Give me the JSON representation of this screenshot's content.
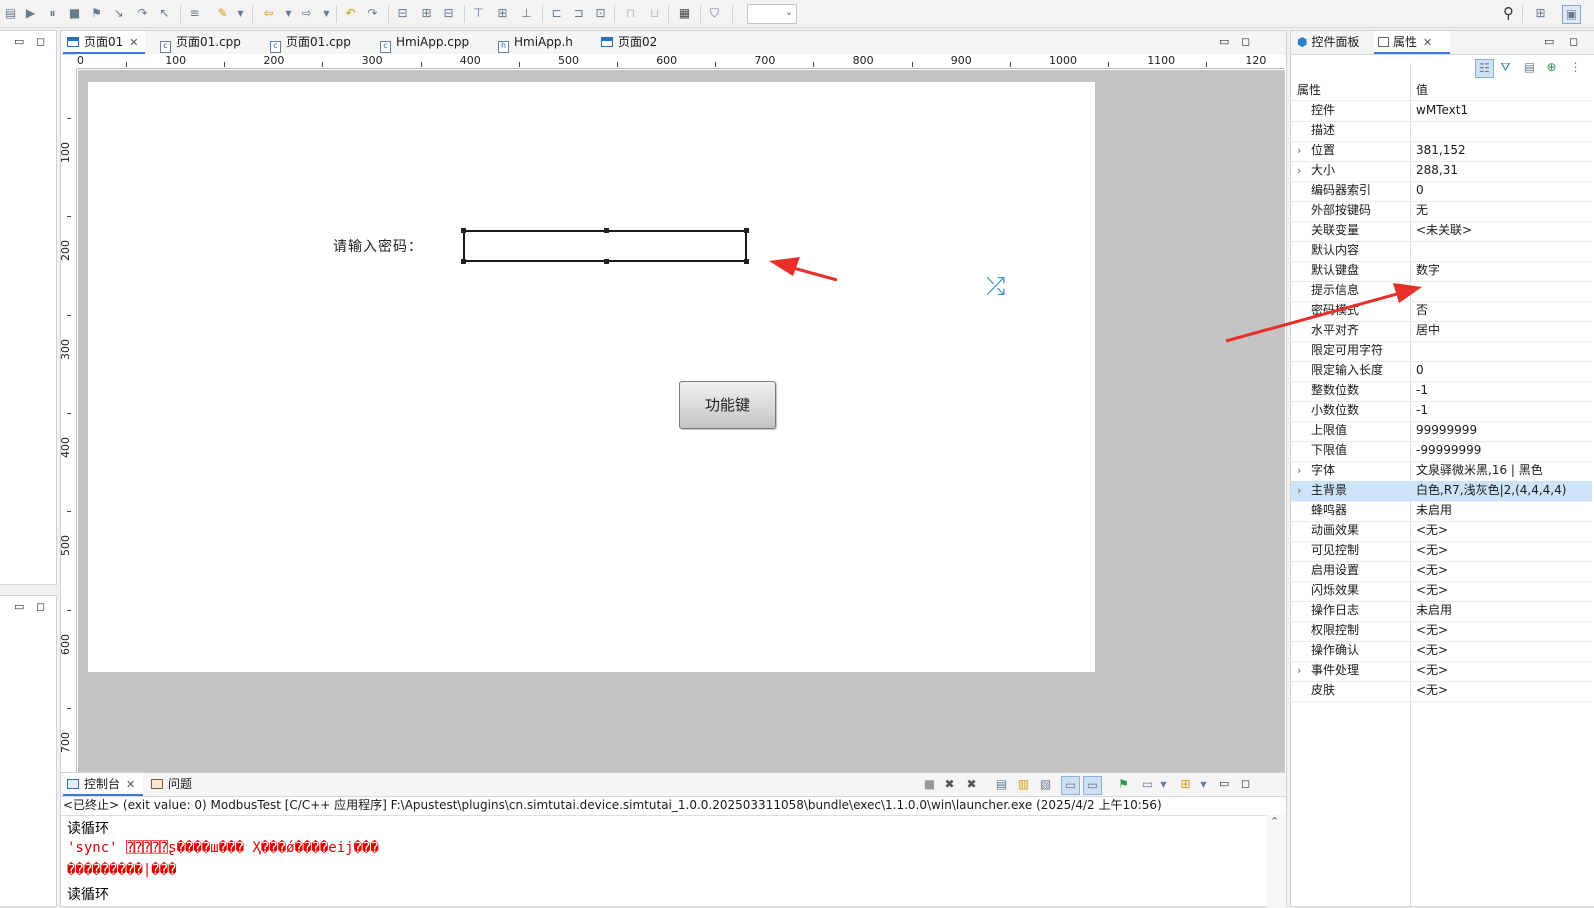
{
  "editor_tabs": [
    {
      "label": "页面01",
      "icon": "page-icon",
      "active": true,
      "closable": true
    },
    {
      "label": "页面01.cpp",
      "icon": "cpp-file-icon"
    },
    {
      "label": "页面01.cpp",
      "icon": "cpp-file-icon"
    },
    {
      "label": "HmiApp.cpp",
      "icon": "cpp-file-icon"
    },
    {
      "label": "HmiApp.h",
      "icon": "header-file-icon"
    },
    {
      "label": "页面02",
      "icon": "page-icon"
    }
  ],
  "ruler": {
    "horizontal": [
      "0",
      "100",
      "200",
      "300",
      "400",
      "500",
      "600",
      "700",
      "800",
      "900",
      "1000",
      "1100",
      "120"
    ],
    "vertical": [
      "100",
      "200",
      "300",
      "400",
      "500",
      "600",
      "700"
    ]
  },
  "canvas": {
    "password_label": "请输入密码：",
    "function_button": "功能键"
  },
  "right_tabs": {
    "widget_panel": "控件面板",
    "properties": "属性"
  },
  "properties": {
    "header_name": "属性",
    "header_value": "值",
    "rows": [
      {
        "name": "控件",
        "value": "wMText1"
      },
      {
        "name": "描述",
        "value": ""
      },
      {
        "name": "位置",
        "value": "381,152",
        "expandable": true
      },
      {
        "name": "大小",
        "value": "288,31",
        "expandable": true
      },
      {
        "name": "编码器索引",
        "value": "0"
      },
      {
        "name": "外部按键码",
        "value": "无"
      },
      {
        "name": "关联变量",
        "value": "<未关联>"
      },
      {
        "name": "默认内容",
        "value": ""
      },
      {
        "name": "默认键盘",
        "value": "数字"
      },
      {
        "name": "提示信息",
        "value": ""
      },
      {
        "name": "密码模式",
        "value": "否"
      },
      {
        "name": "水平对齐",
        "value": "居中"
      },
      {
        "name": "限定可用字符",
        "value": ""
      },
      {
        "name": "限定输入长度",
        "value": "0"
      },
      {
        "name": "整数位数",
        "value": "-1"
      },
      {
        "name": "小数位数",
        "value": "-1"
      },
      {
        "name": "上限值",
        "value": "99999999"
      },
      {
        "name": "下限值",
        "value": "-99999999"
      },
      {
        "name": "字体",
        "value": "文泉驿微米黑,16 | 黑色",
        "expandable": true
      },
      {
        "name": "主背景",
        "value": "白色,R7,浅灰色|2,(4,4,4,4)",
        "expandable": true,
        "selected": true
      },
      {
        "name": "蜂鸣器",
        "value": "未启用"
      },
      {
        "name": "动画效果",
        "value": "<无>"
      },
      {
        "name": "可见控制",
        "value": "<无>"
      },
      {
        "name": "启用设置",
        "value": "<无>"
      },
      {
        "name": "闪烁效果",
        "value": "<无>"
      },
      {
        "name": "操作日志",
        "value": "未启用"
      },
      {
        "name": "权限控制",
        "value": "<无>"
      },
      {
        "name": "操作确认",
        "value": "<无>"
      },
      {
        "name": "事件处理",
        "value": "<无>",
        "expandable": true
      },
      {
        "name": "皮肤",
        "value": "<无>"
      }
    ]
  },
  "console": {
    "tabs": [
      {
        "label": "控制台",
        "icon": "console-icon"
      },
      {
        "label": "问题",
        "icon": "problems-icon"
      }
    ],
    "status_line": "<已终止> (exit value: 0) ModbusTest [C/C++ 应用程序] F:\\Apustest\\plugins\\cn.simtutai.device.simtutai_1.0.0.202503311058\\bundle\\exec\\1.1.0.0\\win\\launcher.exe (2025/4/2 上午10:56)",
    "lines": [
      {
        "text": "读循环",
        "color": "#000000"
      },
      {
        "text": "'sync' ⍰⍰⍰⍰⍰ʂ����ш���  Ҳ���ǿ����eij���",
        "color": "#e00000"
      },
      {
        "text": "���������|���",
        "color": "#e00000"
      },
      {
        "text": "读循环",
        "color": "#000000"
      }
    ]
  },
  "colors": {
    "accent": "#3a7ad2",
    "annotation_arrow": "#e8302a",
    "canvas_bg": "#c4c4c4",
    "selected_row": "#cde3f7"
  }
}
